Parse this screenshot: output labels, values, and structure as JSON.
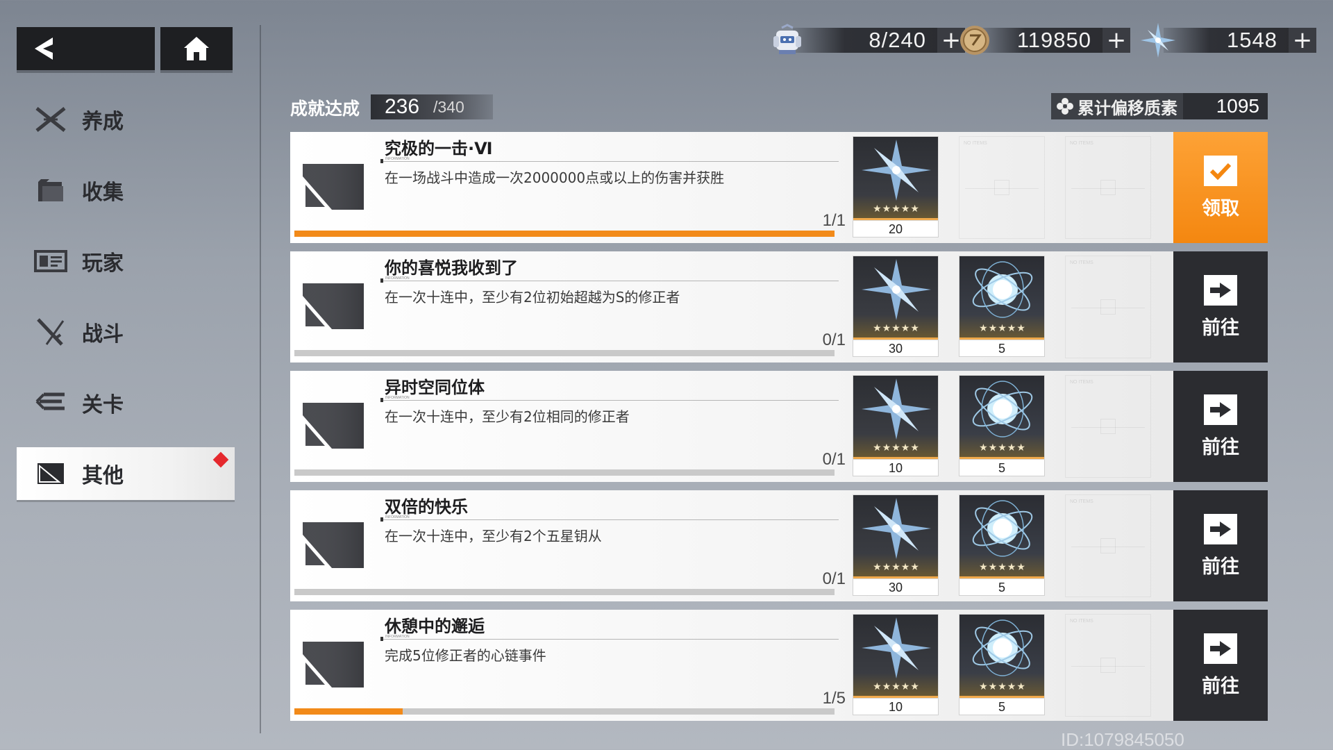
{
  "header": {
    "currencies": [
      {
        "icon": "stamina-robot-icon",
        "value": "8/240"
      },
      {
        "icon": "gold-coin-icon",
        "value": "119850"
      },
      {
        "icon": "crystal-star-icon",
        "value": "1548"
      }
    ],
    "plus_label": "+"
  },
  "sidebar": {
    "items": [
      {
        "label": "养成",
        "icon": "crossed-blades-icon",
        "active": false
      },
      {
        "label": "收集",
        "icon": "folder-icon",
        "active": false
      },
      {
        "label": "玩家",
        "icon": "id-card-icon",
        "active": false
      },
      {
        "label": "战斗",
        "icon": "swords-icon",
        "active": false
      },
      {
        "label": "关卡",
        "icon": "stages-icon",
        "active": false
      },
      {
        "label": "其他",
        "icon": "flag-icon",
        "active": true
      }
    ]
  },
  "progress": {
    "label": "成就达成",
    "current": "236",
    "total": "/340"
  },
  "offset": {
    "label": "累计偏移质素",
    "value": "1095"
  },
  "achievements": [
    {
      "title": "究极的一击·Ⅵ",
      "micro": "INFORMATION",
      "desc": "在一场战斗中造成一次2000000点或以上的伤害并获胜",
      "count": "1/1",
      "progress": 1.0,
      "rewards": [
        {
          "type": "crystal",
          "stars": "★★★★★",
          "qty": "20"
        }
      ],
      "action": {
        "type": "claim",
        "label": "领取"
      }
    },
    {
      "title": "你的喜悦我收到了",
      "micro": "INFORMATION",
      "desc": "在一次十连中，至少有2位初始超越为S的修正者",
      "count": "0/1",
      "progress": 0.0,
      "rewards": [
        {
          "type": "crystal",
          "stars": "★★★★★",
          "qty": "30"
        },
        {
          "type": "orb",
          "stars": "★★★★★",
          "qty": "5"
        }
      ],
      "action": {
        "type": "go",
        "label": "前往"
      }
    },
    {
      "title": "异时空同位体",
      "micro": "INFORMATION",
      "desc": "在一次十连中，至少有2位相同的修正者",
      "count": "0/1",
      "progress": 0.0,
      "rewards": [
        {
          "type": "crystal",
          "stars": "★★★★★",
          "qty": "10"
        },
        {
          "type": "orb",
          "stars": "★★★★★",
          "qty": "5"
        }
      ],
      "action": {
        "type": "go",
        "label": "前往"
      }
    },
    {
      "title": "双倍的快乐",
      "micro": "INFORMATION",
      "desc": "在一次十连中，至少有2个五星钥从",
      "count": "0/1",
      "progress": 0.0,
      "rewards": [
        {
          "type": "crystal",
          "stars": "★★★★★",
          "qty": "30"
        },
        {
          "type": "orb",
          "stars": "★★★★★",
          "qty": "5"
        }
      ],
      "action": {
        "type": "go",
        "label": "前往"
      }
    },
    {
      "title": "休憩中的邂逅",
      "micro": "INFORMATION",
      "desc": "完成5位修正者的心链事件",
      "count": "1/5",
      "progress": 0.2,
      "rewards": [
        {
          "type": "crystal",
          "stars": "★★★★★",
          "qty": "10"
        },
        {
          "type": "orb",
          "stars": "★★★★★",
          "qty": "5"
        }
      ],
      "action": {
        "type": "go",
        "label": "前往"
      }
    }
  ],
  "empty_slot_text": "NO ITEMS",
  "uid": "ID:1079845050",
  "colors": {
    "accent_orange": "#f48710",
    "progress_orange": "#f28a19",
    "dark_button": "#2b2c30",
    "red_dot": "#e5282d"
  }
}
